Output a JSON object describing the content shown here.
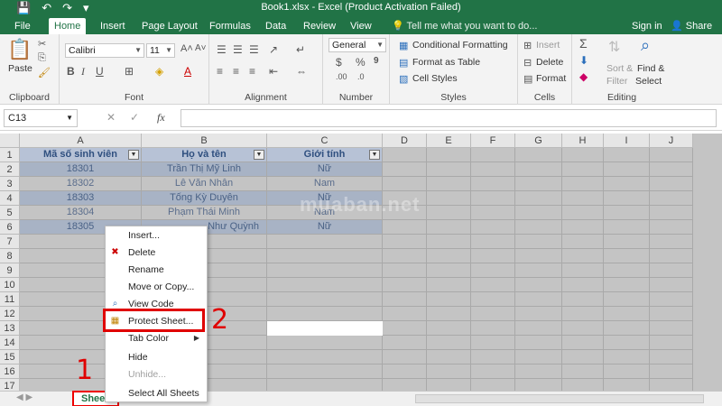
{
  "titlebar": {
    "title": "Book1.xlsx - Excel (Product Activation Failed)",
    "qat": [
      "💾",
      "↶",
      "↷",
      "▾"
    ]
  },
  "tabs": {
    "items": [
      "File",
      "Home",
      "Insert",
      "Page Layout",
      "Formulas",
      "Data",
      "Review",
      "View"
    ],
    "tell_me": "💡 Tell me what you want to do...",
    "sign_in": "Sign in",
    "share": "Share"
  },
  "ribbon": {
    "clipboard": {
      "label": "Clipboard",
      "paste": "Paste"
    },
    "font": {
      "label": "Font",
      "font_name": "Calibri",
      "font_size": "11"
    },
    "alignment": {
      "label": "Alignment"
    },
    "number": {
      "label": "Number",
      "format": "General"
    },
    "styles": {
      "label": "Styles",
      "conditional": "Conditional Formatting",
      "format_table": "Format as Table",
      "cell_styles": "Cell Styles"
    },
    "cells": {
      "label": "Cells",
      "insert": "Insert",
      "delete": "Delete",
      "format": "Format"
    },
    "editing": {
      "label": "Editing",
      "sort": "Sort &",
      "filter": "Filter",
      "find": "Find &",
      "select": "Select"
    }
  },
  "formula_bar": {
    "name_box": "C13",
    "fx": "fx"
  },
  "grid": {
    "columns": [
      "A",
      "B",
      "C",
      "D",
      "E",
      "F",
      "G",
      "H",
      "I",
      "J"
    ],
    "rows": [
      "1",
      "2",
      "3",
      "4",
      "5",
      "6",
      "7",
      "8",
      "9",
      "10",
      "11",
      "12",
      "13",
      "14",
      "15",
      "16",
      "17"
    ],
    "headers": [
      "Mã số sinh viên",
      "Họ và tên",
      "Giới tính"
    ],
    "data": [
      [
        "18301",
        "Trần Thị Mỹ Linh",
        "Nữ"
      ],
      [
        "18302",
        "Lê Văn Nhân",
        "Nam"
      ],
      [
        "18303",
        "Tống Kỳ Duyên",
        "Nữ"
      ],
      [
        "18304",
        "Phạm Thái Minh",
        "Nam"
      ],
      [
        "18305",
        "Như Quỳnh",
        "Nữ"
      ]
    ]
  },
  "sheet_tab": "Sheet",
  "watermark": "muaban.net",
  "context_menu": {
    "items": [
      "Insert...",
      "Delete",
      "Rename",
      "Move or Copy...",
      "View Code",
      "Protect Sheet...",
      "Tab Color",
      "Hide",
      "Unhide...",
      "Select All Sheets"
    ]
  },
  "annotations": {
    "step1": "1",
    "step2": "2",
    "highlight_color": "#e00000"
  }
}
